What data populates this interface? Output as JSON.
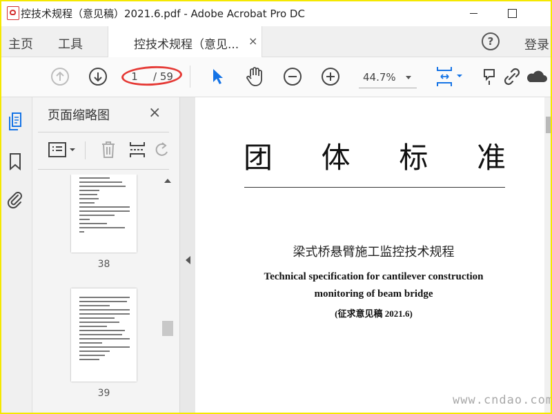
{
  "window": {
    "title": "控技术规程（意见稿）2021.6.pdf - Adobe Acrobat Pro DC"
  },
  "tabbar": {
    "home_label": "主页",
    "tools_label": "工具",
    "document_tab_label": "控技术规程（意见...",
    "close_glyph": "×",
    "help_glyph": "?",
    "login_label": "登录"
  },
  "toolbar": {
    "current_page": "1",
    "total_pages": "/ 59",
    "zoom_level": "44.7%"
  },
  "thumbnail_panel": {
    "title": "页面缩略图",
    "close_glyph": "×",
    "thumbnails": [
      {
        "page_number": "38"
      },
      {
        "page_number": "39"
      }
    ]
  },
  "document": {
    "heading_chars": [
      "团",
      "体",
      "标",
      "准"
    ],
    "cn_title": "梁式桥悬臂施工监控技术规程",
    "en_title_line1": "Technical specification for cantilever construction",
    "en_title_line2": "monitoring of beam bridge",
    "draft_note": "(征求意见稿 2021.6)"
  },
  "watermark": "www.cndao.com",
  "colors": {
    "accent": "#1473e6",
    "annotation": "#e53935",
    "frame": "#f5e800"
  }
}
